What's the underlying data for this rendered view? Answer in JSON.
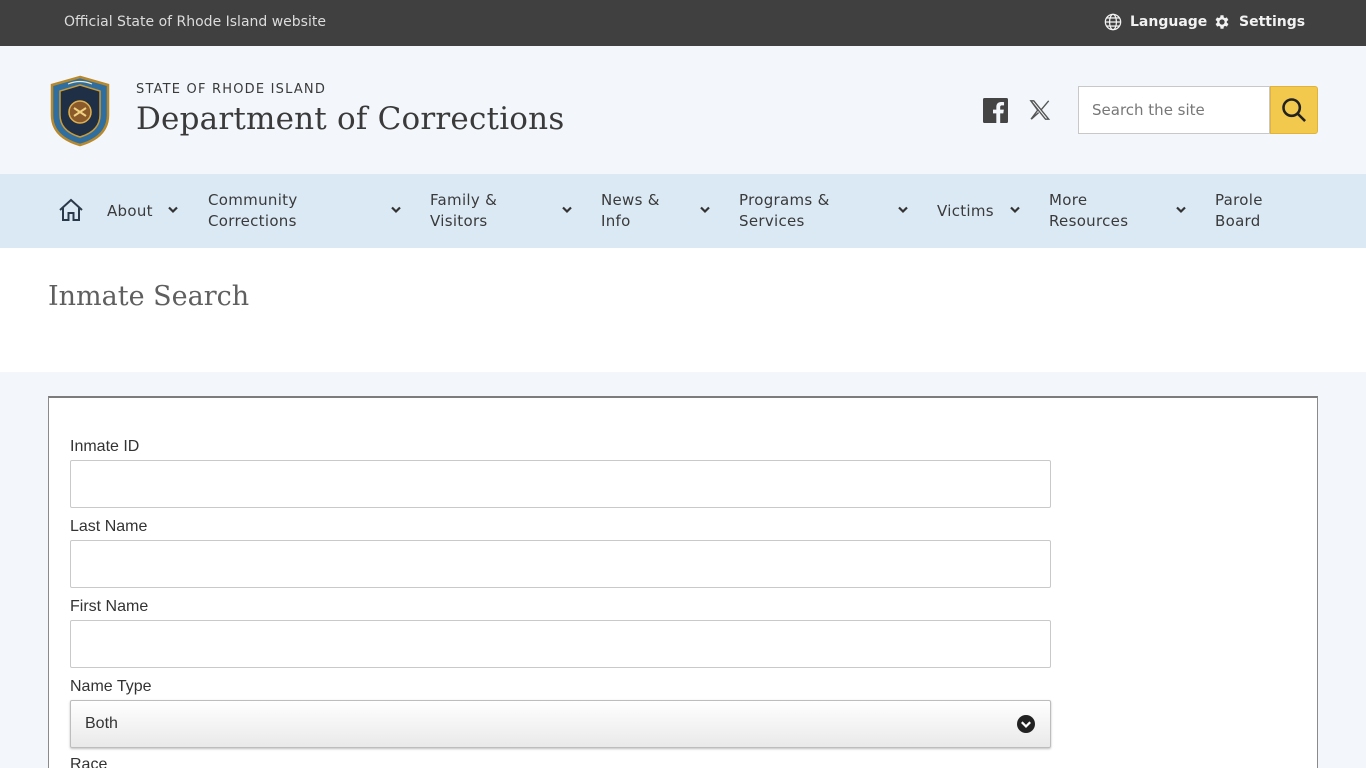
{
  "topbar": {
    "official_text": "Official State of Rhode Island website",
    "language_label": "Language",
    "settings_label": "Settings"
  },
  "header": {
    "state_name": "STATE OF RHODE ISLAND",
    "agency_name": "Department of Corrections",
    "search_placeholder": "Search the site",
    "search_accent": "#f2c94c",
    "social": [
      "facebook-icon",
      "x-icon"
    ]
  },
  "nav": {
    "home_icon": "home-icon",
    "items": [
      {
        "line1": "About",
        "line2": ""
      },
      {
        "line1": "Community",
        "line2": "Corrections"
      },
      {
        "line1": "Family &",
        "line2": "Visitors"
      },
      {
        "line1": "News &",
        "line2": "Info"
      },
      {
        "line1": "Programs &",
        "line2": "Services"
      },
      {
        "line1": "Victims",
        "line2": ""
      },
      {
        "line1": "More",
        "line2": "Resources"
      },
      {
        "line1": "Parole",
        "line2": "Board"
      }
    ]
  },
  "page": {
    "title": "Inmate Search"
  },
  "form": {
    "inmate_id_label": "Inmate ID",
    "inmate_id_value": "",
    "last_name_label": "Last Name",
    "last_name_value": "",
    "first_name_label": "First Name",
    "first_name_value": "",
    "name_type_label": "Name Type",
    "name_type_selected": "Both",
    "race_label": "Race"
  },
  "colors": {
    "topbar": "#404040",
    "header_bg": "#f3f7fb",
    "nav_bg": "#dbe9f5",
    "text": "#3a3a3a"
  }
}
